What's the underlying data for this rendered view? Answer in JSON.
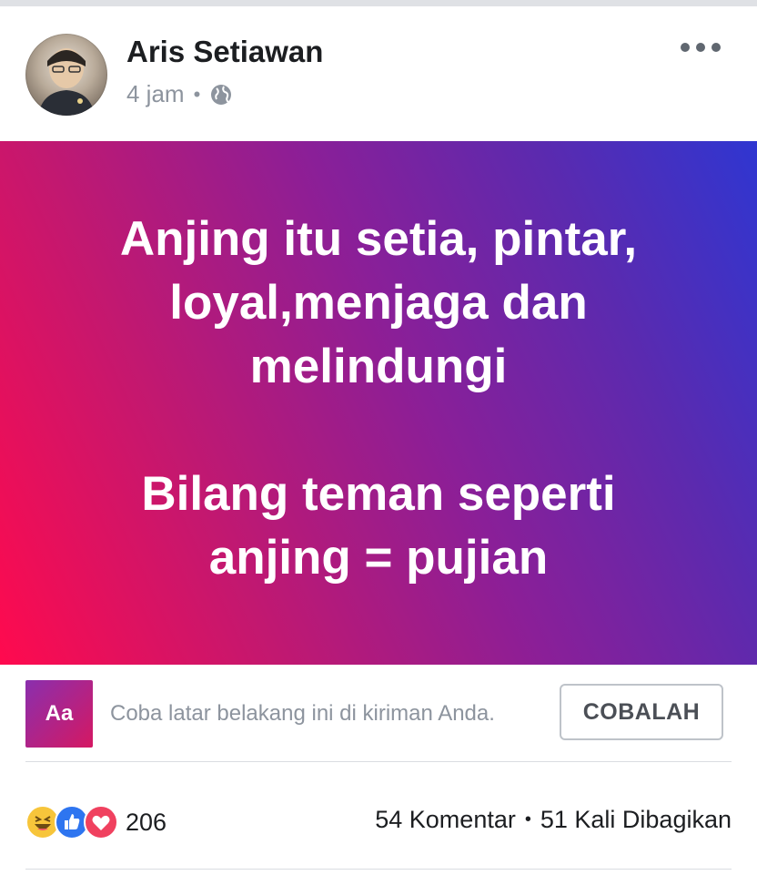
{
  "post": {
    "author": "Aris Setiawan",
    "time": "4 jam",
    "separator": "•",
    "privacy_icon": "globe-icon",
    "text": "Anjing itu setia, pintar,\nloyal,menjaga dan\nmelindungi\n\nBilang teman seperti\nanjing = pujian",
    "background_colors": [
      "#ff0a4e",
      "#8a1f98",
      "#2f36d1"
    ]
  },
  "try_background": {
    "thumb_label": "Aa",
    "text": "Coba latar belakang ini di kiriman Anda.",
    "button_label": "COBALAH"
  },
  "footer": {
    "reactions": [
      "haha-icon",
      "like-icon",
      "love-icon"
    ],
    "reaction_count": "206",
    "comments": "54 Komentar",
    "separator": "•",
    "shares": "51 Kali Dibagikan"
  }
}
